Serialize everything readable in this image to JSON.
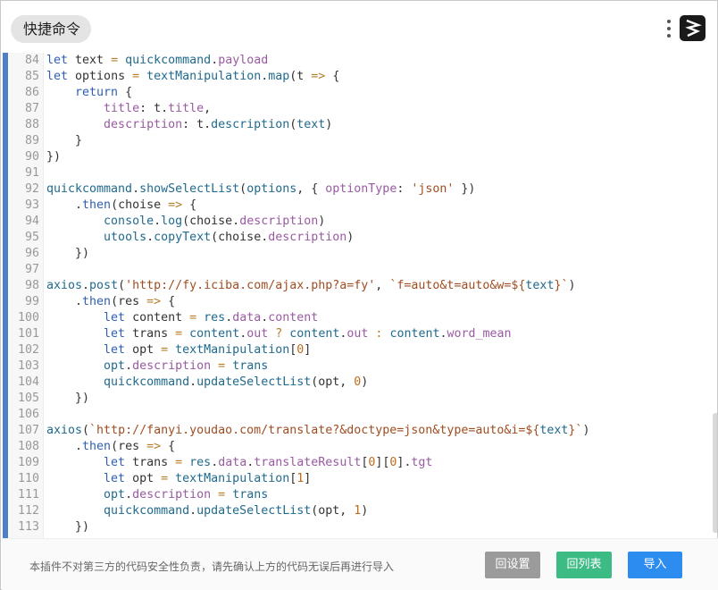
{
  "header": {
    "title": "快捷命令",
    "menu_icon": "kebab-menu-icon",
    "logo_icon": "quickcommand-logo-icon"
  },
  "editor": {
    "lines": [
      {
        "n": "84",
        "html": "<span class=\"k\">let</span> text <span class=\"o\">=</span> <span class=\"v\">quickcommand</span>.<span class=\"p\">payload</span>"
      },
      {
        "n": "85",
        "html": "<span class=\"k\">let</span> options <span class=\"o\">=</span> <span class=\"v\">textManipulation</span>.<span class=\"v\">map</span>(t <span class=\"o\">=&gt;</span> {"
      },
      {
        "n": "86",
        "html": "    <span class=\"k\">return</span> {"
      },
      {
        "n": "87",
        "html": "        <span class=\"p\">title</span>: t.<span class=\"p\">title</span>,"
      },
      {
        "n": "88",
        "html": "        <span class=\"p\">description</span>: t.<span class=\"v\">description</span>(<span class=\"v\">text</span>)"
      },
      {
        "n": "89",
        "html": "    }"
      },
      {
        "n": "90",
        "html": "})"
      },
      {
        "n": "91",
        "html": ""
      },
      {
        "n": "92",
        "html": "<span class=\"v\">quickcommand</span>.<span class=\"v\">showSelectList</span>(<span class=\"v\">options</span>, { <span class=\"p\">optionType</span>: <span class=\"s\">'json'</span> })"
      },
      {
        "n": "93",
        "html": "    .<span class=\"k\">then</span>(choise <span class=\"o\">=&gt;</span> {"
      },
      {
        "n": "94",
        "html": "        <span class=\"v\">console</span>.<span class=\"v\">log</span>(choise.<span class=\"p\">description</span>)"
      },
      {
        "n": "95",
        "html": "        <span class=\"v\">utools</span>.<span class=\"v\">copyText</span>(choise.<span class=\"p\">description</span>)"
      },
      {
        "n": "96",
        "html": "    })"
      },
      {
        "n": "97",
        "html": ""
      },
      {
        "n": "98",
        "html": "<span class=\"v\">axios</span>.<span class=\"v\">post</span>(<span class=\"s\">'http://fy.iciba.com/ajax.php?a=fy'</span>, <span class=\"s\">`f=auto&amp;t=auto&amp;w=${</span><span class=\"v\">text</span><span class=\"s\">}`</span>)"
      },
      {
        "n": "99",
        "html": "    .<span class=\"k\">then</span>(res <span class=\"o\">=&gt;</span> {"
      },
      {
        "n": "100",
        "html": "        <span class=\"k\">let</span> content <span class=\"o\">=</span> <span class=\"v\">res</span>.<span class=\"p\">data</span>.<span class=\"p\">content</span>"
      },
      {
        "n": "101",
        "html": "        <span class=\"k\">let</span> trans <span class=\"o\">=</span> <span class=\"v\">content</span>.<span class=\"p\">out</span> <span class=\"o\">?</span> <span class=\"v\">content</span>.<span class=\"p\">out</span> <span class=\"o\">:</span> <span class=\"v\">content</span>.<span class=\"p\">word_mean</span>"
      },
      {
        "n": "102",
        "html": "        <span class=\"k\">let</span> opt <span class=\"o\">=</span> <span class=\"v\">textManipulation</span>[<span class=\"n\">0</span>]"
      },
      {
        "n": "103",
        "html": "        <span class=\"v\">opt</span>.<span class=\"p\">description</span> <span class=\"o\">=</span> <span class=\"v\">trans</span>"
      },
      {
        "n": "104",
        "html": "        <span class=\"v\">quickcommand</span>.<span class=\"v\">updateSelectList</span>(opt, <span class=\"n\">0</span>)"
      },
      {
        "n": "105",
        "html": "    })"
      },
      {
        "n": "106",
        "html": ""
      },
      {
        "n": "107",
        "html": "<span class=\"v\">axios</span>(<span class=\"s\">`http://fanyi.youdao.com/translate?&amp;doctype=json&amp;type=auto&amp;i=${</span><span class=\"v\">text</span><span class=\"s\">}`</span>)"
      },
      {
        "n": "108",
        "html": "    .<span class=\"k\">then</span>(res <span class=\"o\">=&gt;</span> {"
      },
      {
        "n": "109",
        "html": "        <span class=\"k\">let</span> trans <span class=\"o\">=</span> <span class=\"v\">res</span>.<span class=\"p\">data</span>.<span class=\"p\">translateResult</span>[<span class=\"n\">0</span>][<span class=\"n\">0</span>].<span class=\"p\">tgt</span>"
      },
      {
        "n": "110",
        "html": "        <span class=\"k\">let</span> opt <span class=\"o\">=</span> <span class=\"v\">textManipulation</span>[<span class=\"n\">1</span>]"
      },
      {
        "n": "111",
        "html": "        <span class=\"v\">opt</span>.<span class=\"p\">description</span> <span class=\"o\">=</span> <span class=\"v\">trans</span>"
      },
      {
        "n": "112",
        "html": "        <span class=\"v\">quickcommand</span>.<span class=\"v\">updateSelectList</span>(opt, <span class=\"n\">1</span>)"
      },
      {
        "n": "113",
        "html": "    })"
      }
    ]
  },
  "footer": {
    "notice": "本插件不对第三方的代码安全性负责，请先确认上方的代码无误后再进行导入",
    "btn_settings": "回设置",
    "btn_list": "回列表",
    "btn_import": "导入"
  },
  "colors": {
    "accent_bar": "#4f7fc9",
    "btn_settings": "#9b9b9b",
    "btn_list": "#3dbb84",
    "btn_import": "#2d8cf0"
  }
}
